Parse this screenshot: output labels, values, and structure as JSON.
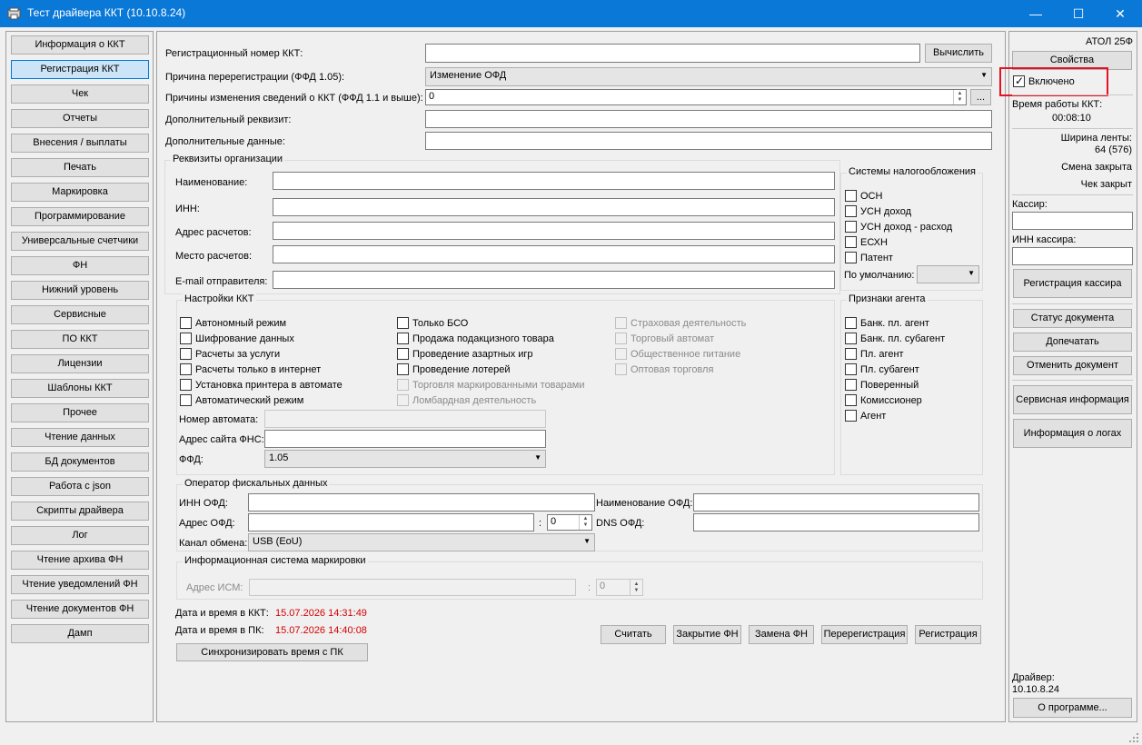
{
  "window": {
    "title": "Тест драйвера ККТ (10.10.8.24)",
    "minimize": "—",
    "maximize": "☐",
    "close": "✕"
  },
  "sidebar": {
    "items": [
      {
        "label": "Информация о ККТ"
      },
      {
        "label": "Регистрация ККТ"
      },
      {
        "label": "Чек"
      },
      {
        "label": "Отчеты"
      },
      {
        "label": "Внесения / выплаты"
      },
      {
        "label": "Печать"
      },
      {
        "label": "Маркировка"
      },
      {
        "label": "Программирование"
      },
      {
        "label": "Универсальные счетчики"
      },
      {
        "label": "ФН"
      },
      {
        "label": "Нижний уровень"
      },
      {
        "label": "Сервисные"
      },
      {
        "label": "ПО ККТ"
      },
      {
        "label": "Лицензии"
      },
      {
        "label": "Шаблоны ККТ"
      },
      {
        "label": "Прочее"
      },
      {
        "label": "Чтение данных"
      },
      {
        "label": "БД документов"
      },
      {
        "label": "Работа с json"
      },
      {
        "label": "Скрипты драйвера"
      },
      {
        "label": "Лог"
      },
      {
        "label": "Чтение архива ФН"
      },
      {
        "label": "Чтение уведомлений ФН"
      },
      {
        "label": "Чтение документов ФН"
      },
      {
        "label": "Дамп"
      }
    ],
    "selected_index": 1
  },
  "top": {
    "reg_number_label": "Регистрационный номер ККТ:",
    "reg_number_value": "",
    "calc_button": "Вычислить",
    "rereg_reason_label": "Причина перерегистрации (ФФД 1.05):",
    "rereg_reason_value": "Изменение ОФД",
    "change_reasons_label": "Причины изменения сведений о ККТ (ФФД 1.1 и выше):",
    "change_reasons_value": "0",
    "ellipsis_button": "...",
    "extra_req_label": "Дополнительный реквизит:",
    "extra_req_value": "",
    "extra_data_label": "Дополнительные данные:",
    "extra_data_value": ""
  },
  "org": {
    "group_title": "Реквизиты организации",
    "name_label": "Наименование:",
    "inn_label": "ИНН:",
    "address_label": "Адрес расчетов:",
    "place_label": "Место расчетов:",
    "email_label": "E-mail отправителя:"
  },
  "tax": {
    "group_title": "Системы налогообложения",
    "items": [
      {
        "label": "ОСН"
      },
      {
        "label": "УСН доход"
      },
      {
        "label": "УСН доход - расход"
      },
      {
        "label": "ЕСХН"
      },
      {
        "label": "Патент"
      }
    ],
    "default_label": "По умолчанию:",
    "default_value": ""
  },
  "kkt_settings": {
    "group_title": "Настройки ККТ",
    "col1": [
      {
        "label": "Автономный режим"
      },
      {
        "label": "Шифрование данных"
      },
      {
        "label": "Расчеты за услуги"
      },
      {
        "label": "Расчеты только в интернет"
      },
      {
        "label": "Установка принтера в автомате"
      },
      {
        "label": "Автоматический режим"
      }
    ],
    "col2": [
      {
        "label": "Только БСО"
      },
      {
        "label": "Продажа подакцизного товара"
      },
      {
        "label": "Проведение азартных игр"
      },
      {
        "label": "Проведение лотерей"
      },
      {
        "label": "Торговля маркированными товарами"
      },
      {
        "label": "Ломбардная деятельность"
      }
    ],
    "col3": [
      {
        "label": "Страховая деятельность"
      },
      {
        "label": "Торговый автомат"
      },
      {
        "label": "Общественное питание"
      },
      {
        "label": "Оптовая торговля"
      }
    ],
    "automat_number_label": "Номер автомата:",
    "fns_site_label": "Адрес сайта ФНС:",
    "ffd_label": "ФФД:",
    "ffd_value": "1.05"
  },
  "agent": {
    "group_title": "Признаки агента",
    "items": [
      {
        "label": "Банк. пл. агент"
      },
      {
        "label": "Банк. пл. субагент"
      },
      {
        "label": "Пл. агент"
      },
      {
        "label": "Пл. субагент"
      },
      {
        "label": "Поверенный"
      },
      {
        "label": "Комиссионер"
      },
      {
        "label": "Агент"
      }
    ]
  },
  "ofd": {
    "group_title": "Оператор фискальных данных",
    "inn_label": "ИНН ОФД:",
    "name_label": "Наименование ОФД:",
    "address_label": "Адрес ОФД:",
    "port_sep": ":",
    "port_value": "0",
    "dns_label": "DNS ОФД:",
    "channel_label": "Канал обмена:",
    "channel_value": "USB (EoU)"
  },
  "ism": {
    "group_title": "Информационная система маркировки",
    "address_label": "Адрес ИСМ:",
    "port_sep": ":",
    "port_value": "0"
  },
  "datetime": {
    "kkt_label": "Дата и время в ККТ:",
    "kkt_value": "15.07.2026 14:31:49",
    "pc_label": "Дата и время в ПК:",
    "pc_value": "15.07.2026 14:40:08",
    "sync_button": "Синхронизировать время с ПК"
  },
  "actions": {
    "read": "Считать",
    "close_fn": "Закрытие ФН",
    "replace_fn": "Замена ФН",
    "rereg": "Перерегистрация",
    "reg": "Регистрация"
  },
  "right": {
    "model": "АТОЛ 25Ф",
    "properties_button": "Свойства",
    "enabled_label": "Включено",
    "uptime_label": "Время работы ККТ:",
    "uptime_value": "00:08:10",
    "tape_label": "Ширина ленты:",
    "tape_value": "64 (576)",
    "shift_status": "Смена закрыта",
    "receipt_status": "Чек закрыт",
    "cashier_label": "Кассир:",
    "cashier_inn_label": "ИНН кассира:",
    "cashier_reg_button": "Регистрация кассира",
    "doc_status_button": "Статус документа",
    "reprint_button": "Допечатать",
    "cancel_doc_button": "Отменить документ",
    "service_info_button": "Сервисная информация",
    "log_info_button": "Информация о логах",
    "driver_label": "Драйвер:",
    "driver_version": "10.10.8.24",
    "about_button": "О программе..."
  },
  "colors": {
    "titlebar": "#0a78d7",
    "highlight": "#e81123",
    "red_text": "#d40000"
  }
}
